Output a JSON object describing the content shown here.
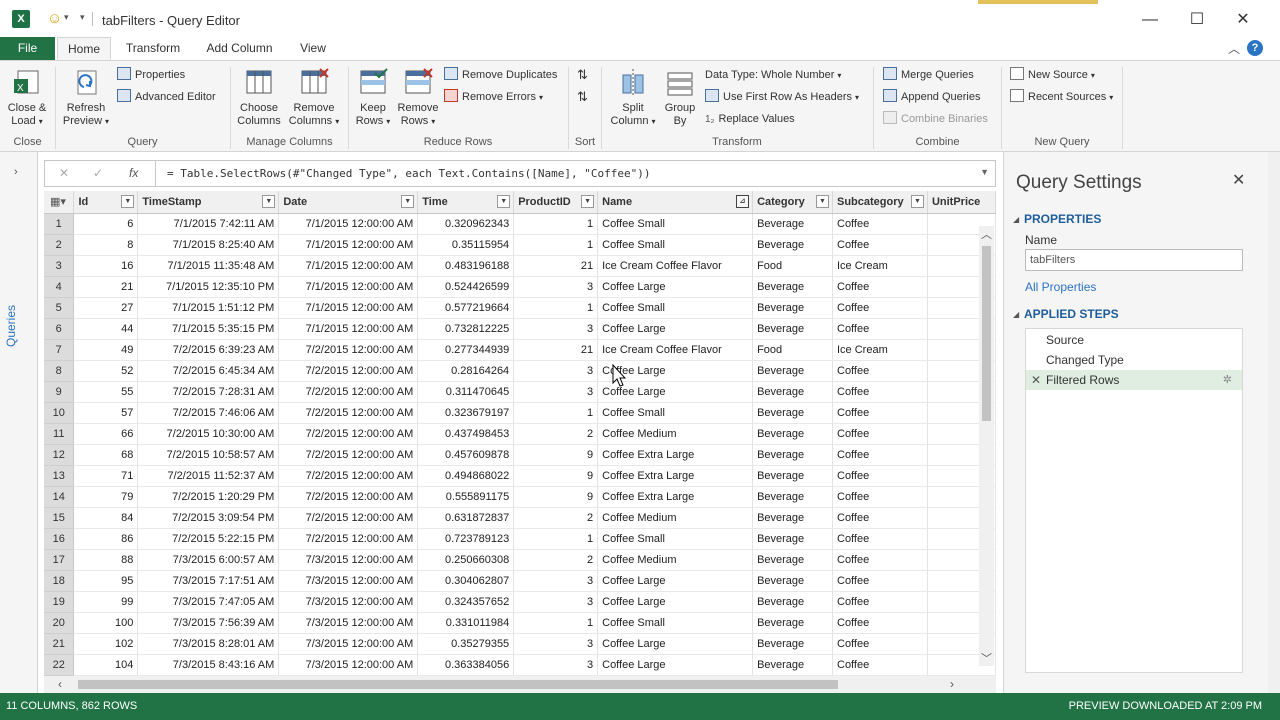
{
  "window": {
    "title": "tabFilters - Query Editor",
    "min_glyph": "—",
    "max_glyph": "☐",
    "close_glyph": "✕"
  },
  "tabs": {
    "file": "File",
    "items": [
      "Home",
      "Transform",
      "Add Column",
      "View"
    ]
  },
  "ribbon": {
    "close": {
      "btn1": "Close &",
      "btn1b": "Load",
      "label": "Close"
    },
    "query": {
      "refresh": "Refresh",
      "refresh2": "Preview",
      "properties": "Properties",
      "advanced": "Advanced Editor",
      "label": "Query"
    },
    "manage": {
      "choose": "Choose",
      "choose2": "Columns",
      "remove": "Remove",
      "remove2": "Columns",
      "label": "Manage Columns"
    },
    "reduce": {
      "keep": "Keep",
      "keep2": "Rows",
      "remove": "Remove",
      "remove2": "Rows",
      "dups": "Remove Duplicates",
      "errors": "Remove Errors",
      "label": "Reduce Rows"
    },
    "sort": {
      "label": "Sort"
    },
    "transform": {
      "split": "Split",
      "split2": "Column",
      "group": "Group",
      "group2": "By",
      "datatype": "Data Type: Whole Number",
      "headers": "Use First Row As Headers",
      "replace": "Replace Values",
      "label": "Transform"
    },
    "combine": {
      "merge": "Merge Queries",
      "append": "Append Queries",
      "binaries": "Combine Binaries",
      "label": "Combine"
    },
    "newquery": {
      "newsource": "New Source",
      "recent": "Recent Sources",
      "label": "New Query"
    }
  },
  "left_pane": {
    "label": "Queries"
  },
  "formula": {
    "text": "= Table.SelectRows(#\"Changed Type\", each Text.Contains([Name], \"Coffee\"))"
  },
  "grid": {
    "columns": [
      "Id",
      "TimeStamp",
      "Date",
      "Time",
      "ProductID",
      "Name",
      "Category",
      "Subcategory",
      "UnitPrice"
    ],
    "rows": [
      [
        "1",
        "6",
        "7/1/2015 7:42:11 AM",
        "7/1/2015 12:00:00 AM",
        "0.320962343",
        "1",
        "Coffee Small",
        "Beverage",
        "Coffee"
      ],
      [
        "2",
        "8",
        "7/1/2015 8:25:40 AM",
        "7/1/2015 12:00:00 AM",
        "0.35115954",
        "1",
        "Coffee Small",
        "Beverage",
        "Coffee"
      ],
      [
        "3",
        "16",
        "7/1/2015 11:35:48 AM",
        "7/1/2015 12:00:00 AM",
        "0.483196188",
        "21",
        "Ice Cream Coffee Flavor",
        "Food",
        "Ice Cream"
      ],
      [
        "4",
        "21",
        "7/1/2015 12:35:10 PM",
        "7/1/2015 12:00:00 AM",
        "0.524426599",
        "3",
        "Coffee Large",
        "Beverage",
        "Coffee"
      ],
      [
        "5",
        "27",
        "7/1/2015 1:51:12 PM",
        "7/1/2015 12:00:00 AM",
        "0.577219664",
        "1",
        "Coffee Small",
        "Beverage",
        "Coffee"
      ],
      [
        "6",
        "44",
        "7/1/2015 5:35:15 PM",
        "7/1/2015 12:00:00 AM",
        "0.732812225",
        "3",
        "Coffee Large",
        "Beverage",
        "Coffee"
      ],
      [
        "7",
        "49",
        "7/2/2015 6:39:23 AM",
        "7/2/2015 12:00:00 AM",
        "0.277344939",
        "21",
        "Ice Cream Coffee Flavor",
        "Food",
        "Ice Cream"
      ],
      [
        "8",
        "52",
        "7/2/2015 6:45:34 AM",
        "7/2/2015 12:00:00 AM",
        "0.28164264",
        "3",
        "Coffee Large",
        "Beverage",
        "Coffee"
      ],
      [
        "9",
        "55",
        "7/2/2015 7:28:31 AM",
        "7/2/2015 12:00:00 AM",
        "0.311470645",
        "3",
        "Coffee Large",
        "Beverage",
        "Coffee"
      ],
      [
        "10",
        "57",
        "7/2/2015 7:46:06 AM",
        "7/2/2015 12:00:00 AM",
        "0.323679197",
        "1",
        "Coffee Small",
        "Beverage",
        "Coffee"
      ],
      [
        "11",
        "66",
        "7/2/2015 10:30:00 AM",
        "7/2/2015 12:00:00 AM",
        "0.437498453",
        "2",
        "Coffee Medium",
        "Beverage",
        "Coffee"
      ],
      [
        "12",
        "68",
        "7/2/2015 10:58:57 AM",
        "7/2/2015 12:00:00 AM",
        "0.457609878",
        "9",
        "Coffee Extra Large",
        "Beverage",
        "Coffee"
      ],
      [
        "13",
        "71",
        "7/2/2015 11:52:37 AM",
        "7/2/2015 12:00:00 AM",
        "0.494868022",
        "9",
        "Coffee Extra Large",
        "Beverage",
        "Coffee"
      ],
      [
        "14",
        "79",
        "7/2/2015 1:20:29 PM",
        "7/2/2015 12:00:00 AM",
        "0.555891175",
        "9",
        "Coffee Extra Large",
        "Beverage",
        "Coffee"
      ],
      [
        "15",
        "84",
        "7/2/2015 3:09:54 PM",
        "7/2/2015 12:00:00 AM",
        "0.631872837",
        "2",
        "Coffee Medium",
        "Beverage",
        "Coffee"
      ],
      [
        "16",
        "86",
        "7/2/2015 5:22:15 PM",
        "7/2/2015 12:00:00 AM",
        "0.723789123",
        "1",
        "Coffee Small",
        "Beverage",
        "Coffee"
      ],
      [
        "17",
        "88",
        "7/3/2015 6:00:57 AM",
        "7/3/2015 12:00:00 AM",
        "0.250660308",
        "2",
        "Coffee Medium",
        "Beverage",
        "Coffee"
      ],
      [
        "18",
        "95",
        "7/3/2015 7:17:51 AM",
        "7/3/2015 12:00:00 AM",
        "0.304062807",
        "3",
        "Coffee Large",
        "Beverage",
        "Coffee"
      ],
      [
        "19",
        "99",
        "7/3/2015 7:47:05 AM",
        "7/3/2015 12:00:00 AM",
        "0.324357652",
        "3",
        "Coffee Large",
        "Beverage",
        "Coffee"
      ],
      [
        "20",
        "100",
        "7/3/2015 7:56:39 AM",
        "7/3/2015 12:00:00 AM",
        "0.331011984",
        "1",
        "Coffee Small",
        "Beverage",
        "Coffee"
      ],
      [
        "21",
        "102",
        "7/3/2015 8:28:01 AM",
        "7/3/2015 12:00:00 AM",
        "0.35279355",
        "3",
        "Coffee Large",
        "Beverage",
        "Coffee"
      ],
      [
        "22",
        "104",
        "7/3/2015 8:43:16 AM",
        "7/3/2015 12:00:00 AM",
        "0.363384056",
        "3",
        "Coffee Large",
        "Beverage",
        "Coffee"
      ]
    ]
  },
  "query_settings": {
    "title": "Query Settings",
    "properties": "PROPERTIES",
    "name_label": "Name",
    "name_value": "tabFilters",
    "all_properties": "All Properties",
    "applied_steps": "APPLIED STEPS",
    "steps": [
      "Source",
      "Changed Type",
      "Filtered Rows"
    ]
  },
  "status": {
    "left": "11 COLUMNS, 862 ROWS",
    "right": "PREVIEW DOWNLOADED AT 2:09 PM"
  },
  "colors": {
    "excel_green": "#217346",
    "accent_blue": "#2a74c5",
    "selected_step": "#dfeee1"
  }
}
